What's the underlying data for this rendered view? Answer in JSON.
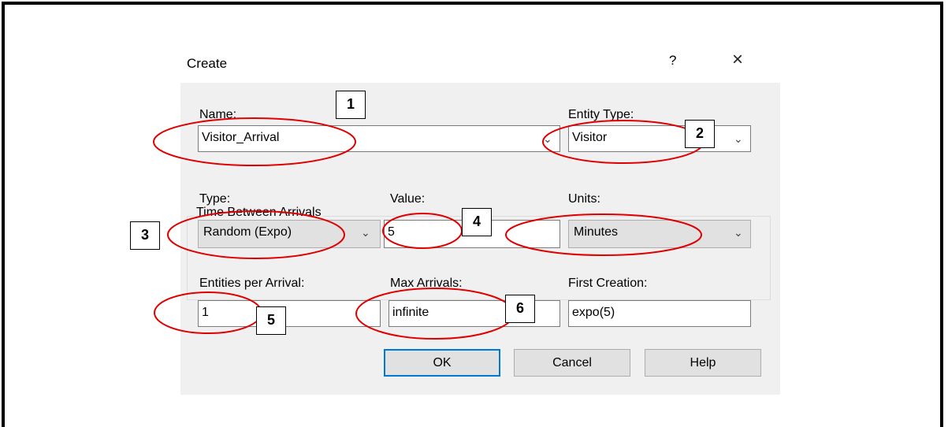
{
  "dialog": {
    "title": "Create",
    "help_glyph": "?",
    "close_glyph": "×"
  },
  "fields": {
    "name_label": "Name:",
    "name_value": "Visitor_Arrival",
    "entity_type_label": "Entity Type:",
    "entity_type_value": "Visitor",
    "group_label": "Time Between Arrivals",
    "type_label": "Type:",
    "type_value": "Random (Expo)",
    "value_label": "Value:",
    "value_value": "5",
    "units_label": "Units:",
    "units_value": "Minutes",
    "entities_label": "Entities per Arrival:",
    "entities_value": "1",
    "max_label": "Max Arrivals:",
    "max_value": "infinite",
    "first_label": "First Creation:",
    "first_value": "expo(5)"
  },
  "buttons": {
    "ok": "OK",
    "cancel": "Cancel",
    "help": "Help"
  },
  "callouts": [
    "1",
    "2",
    "3",
    "4",
    "5",
    "6"
  ],
  "annotation_color": "#e00000"
}
